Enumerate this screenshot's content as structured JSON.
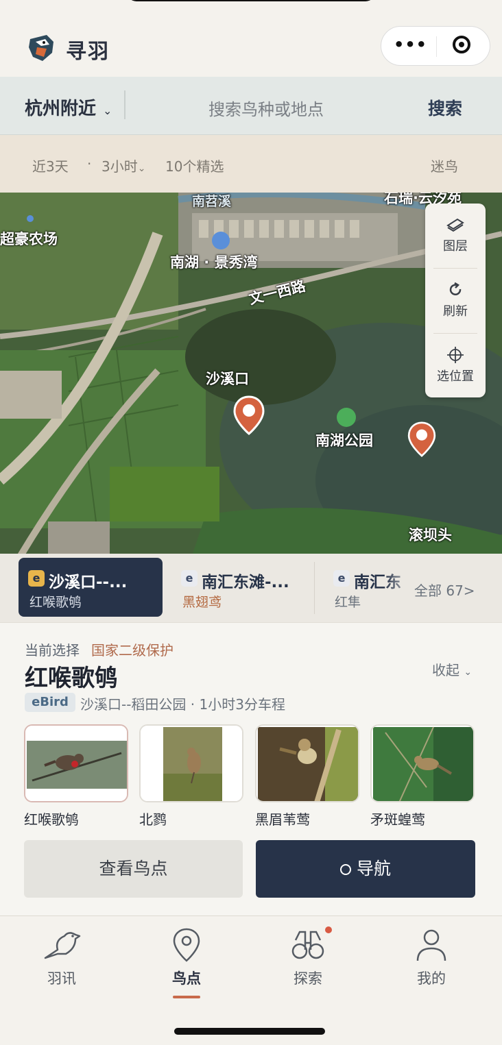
{
  "app": {
    "title": "寻羽"
  },
  "search": {
    "city": "杭州附近",
    "placeholder": "搜索鸟种或地点",
    "button": "搜索"
  },
  "filters": {
    "days": "近3天",
    "separator": "·",
    "hours": "3小时",
    "selection": "10个精选",
    "mode": "迷鸟"
  },
  "map": {
    "labels": [
      "超豪农场",
      "南湖 · 景秀湾",
      "文一西路",
      "沙溪口",
      "南湖公园",
      "滚坝头",
      "南苕溪",
      "石瑞·云汐苑"
    ],
    "tools": [
      {
        "label": "图层",
        "icon": "layers-icon"
      },
      {
        "label": "刷新",
        "icon": "refresh-icon"
      },
      {
        "label": "选位置",
        "icon": "crosshair-icon"
      }
    ]
  },
  "spots": [
    {
      "badge": "e",
      "name": "沙溪口--...",
      "bird": "红喉歌鸲",
      "active": true
    },
    {
      "badge": "e",
      "name": "南汇东滩-...",
      "bird": "黑翅鸢",
      "active": false
    },
    {
      "badge": "e",
      "name": "南汇东",
      "bird": "红隼",
      "active": false
    }
  ],
  "spots_all": "全部 67>",
  "detail": {
    "current_label": "当前选择",
    "protection": "国家二级保护",
    "bird": "红喉歌鸲",
    "collapse": "收起",
    "source": "eBird",
    "location": "沙溪口--稻田公园 · 1小时3分车程",
    "thumbs": [
      "红喉歌鸲",
      "北鹨",
      "黑眉苇莺",
      "矛斑蝗莺"
    ],
    "btn_view": "查看鸟点",
    "btn_nav": "导航"
  },
  "tabs": [
    "羽讯",
    "鸟点",
    "探索",
    "我的"
  ],
  "colors": {
    "navy": "#273349",
    "accent": "#c86a4b",
    "pin": "#d4623f"
  }
}
